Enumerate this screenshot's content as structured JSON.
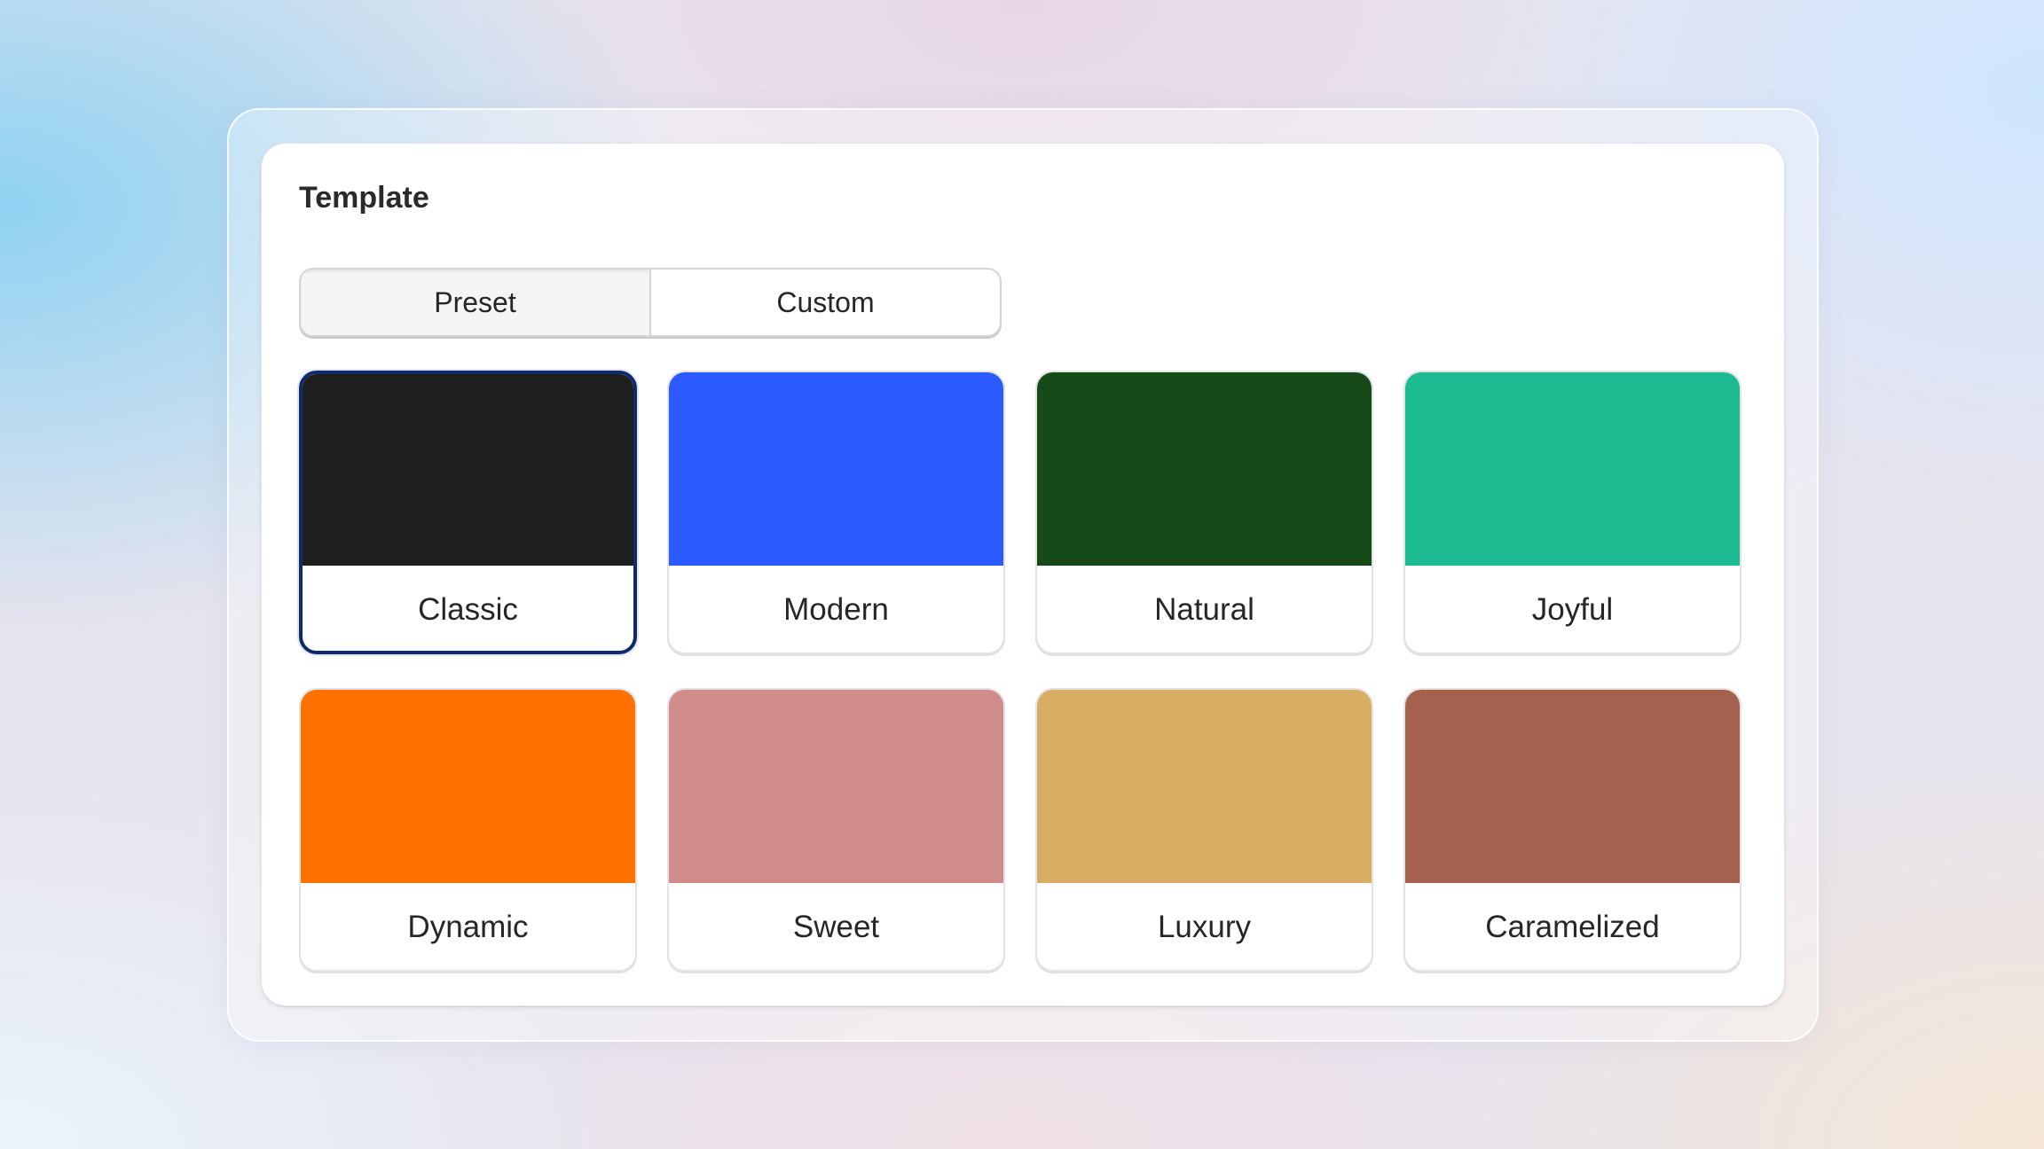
{
  "panel": {
    "title": "Template"
  },
  "tabs": {
    "preset_label": "Preset",
    "custom_label": "Custom",
    "active": "Preset"
  },
  "templates": [
    {
      "name": "Classic",
      "color": "#1e1e1e",
      "selected": true
    },
    {
      "name": "Modern",
      "color": "#2b5bff",
      "selected": false
    },
    {
      "name": "Natural",
      "color": "#164a18",
      "selected": false
    },
    {
      "name": "Joyful",
      "color": "#1dbb91",
      "selected": false
    },
    {
      "name": "Dynamic",
      "color": "#ff7100",
      "selected": false
    },
    {
      "name": "Sweet",
      "color": "#d08b8b",
      "selected": false
    },
    {
      "name": "Luxury",
      "color": "#d6ad62",
      "selected": false
    },
    {
      "name": "Caramelized",
      "color": "#a4614d",
      "selected": false
    }
  ]
}
